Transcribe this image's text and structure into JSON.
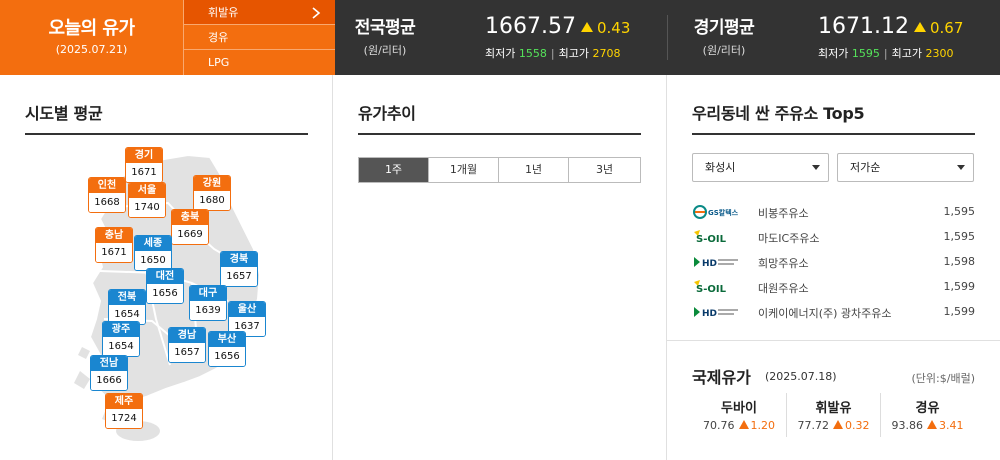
{
  "header": {
    "title": "오늘의 유가",
    "date": "(2025.07.21)",
    "fuel_tabs": [
      {
        "label": "휘발유",
        "active": true
      },
      {
        "label": "경유",
        "active": false
      },
      {
        "label": "LPG",
        "active": false
      }
    ],
    "national": {
      "title": "전국평균",
      "unit": "(원/리터)",
      "price": "1667.57",
      "change": "0.43",
      "min_label": "최저가",
      "min": "1558",
      "max_label": "최고가",
      "max": "2708"
    },
    "gyeonggi": {
      "title": "경기평균",
      "unit": "(원/리터)",
      "price": "1671.12",
      "change": "0.67",
      "min_label": "최저가",
      "min": "1595",
      "max_label": "최고가",
      "max": "2300"
    },
    "colors": {
      "brand": "#f36e0f",
      "dark": "#333333",
      "up": "#ffd400",
      "low": "#55e35a"
    }
  },
  "regional": {
    "title": "시도별 평균",
    "pins": [
      {
        "name": "경기",
        "value": "1671",
        "color": "orange"
      },
      {
        "name": "인천",
        "value": "1668",
        "color": "orange"
      },
      {
        "name": "서울",
        "value": "1740",
        "color": "orange"
      },
      {
        "name": "강원",
        "value": "1680",
        "color": "orange"
      },
      {
        "name": "충북",
        "value": "1669",
        "color": "orange"
      },
      {
        "name": "충남",
        "value": "1671",
        "color": "orange"
      },
      {
        "name": "세종",
        "value": "1650",
        "color": "blue"
      },
      {
        "name": "경북",
        "value": "1657",
        "color": "blue"
      },
      {
        "name": "대전",
        "value": "1656",
        "color": "blue"
      },
      {
        "name": "전북",
        "value": "1654",
        "color": "blue"
      },
      {
        "name": "대구",
        "value": "1639",
        "color": "blue"
      },
      {
        "name": "울산",
        "value": "1637",
        "color": "blue"
      },
      {
        "name": "광주",
        "value": "1654",
        "color": "blue"
      },
      {
        "name": "경남",
        "value": "1657",
        "color": "blue"
      },
      {
        "name": "부산",
        "value": "1656",
        "color": "blue"
      },
      {
        "name": "전남",
        "value": "1666",
        "color": "blue"
      },
      {
        "name": "제주",
        "value": "1724",
        "color": "orange"
      }
    ]
  },
  "trend": {
    "title": "유가추이",
    "periods": [
      {
        "label": "1주",
        "active": true
      },
      {
        "label": "1개월",
        "active": false
      },
      {
        "label": "1년",
        "active": false
      },
      {
        "label": "3년",
        "active": false
      }
    ]
  },
  "top5": {
    "title": "우리동네 싼 주유소 Top5",
    "region_select": "화성시",
    "sort_select": "저가순",
    "stations": [
      {
        "brand": "GS칼텍스",
        "brand_icon": "gs-caltex-logo",
        "name": "비봉주유소",
        "price": "1,595"
      },
      {
        "brand": "S-OIL",
        "brand_icon": "s-oil-logo",
        "name": "마도IC주유소",
        "price": "1,595"
      },
      {
        "brand": "HD",
        "brand_icon": "hd-hyundai-oilbank-logo",
        "name": "희망주유소",
        "price": "1,598"
      },
      {
        "brand": "S-OIL",
        "brand_icon": "s-oil-logo",
        "name": "대원주유소",
        "price": "1,599"
      },
      {
        "brand": "HD",
        "brand_icon": "hd-hyundai-oilbank-logo",
        "name": "이케이에너지(주) 광차주유소",
        "price": "1,599"
      }
    ]
  },
  "international": {
    "title": "국제유가",
    "date": "(2025.07.18)",
    "unit": "(단위:$/배럴)",
    "items": [
      {
        "name": "두바이",
        "value": "70.76",
        "change": "1.20"
      },
      {
        "name": "휘발유",
        "value": "77.72",
        "change": "0.32"
      },
      {
        "name": "경유",
        "value": "93.86",
        "change": "3.41"
      }
    ]
  }
}
